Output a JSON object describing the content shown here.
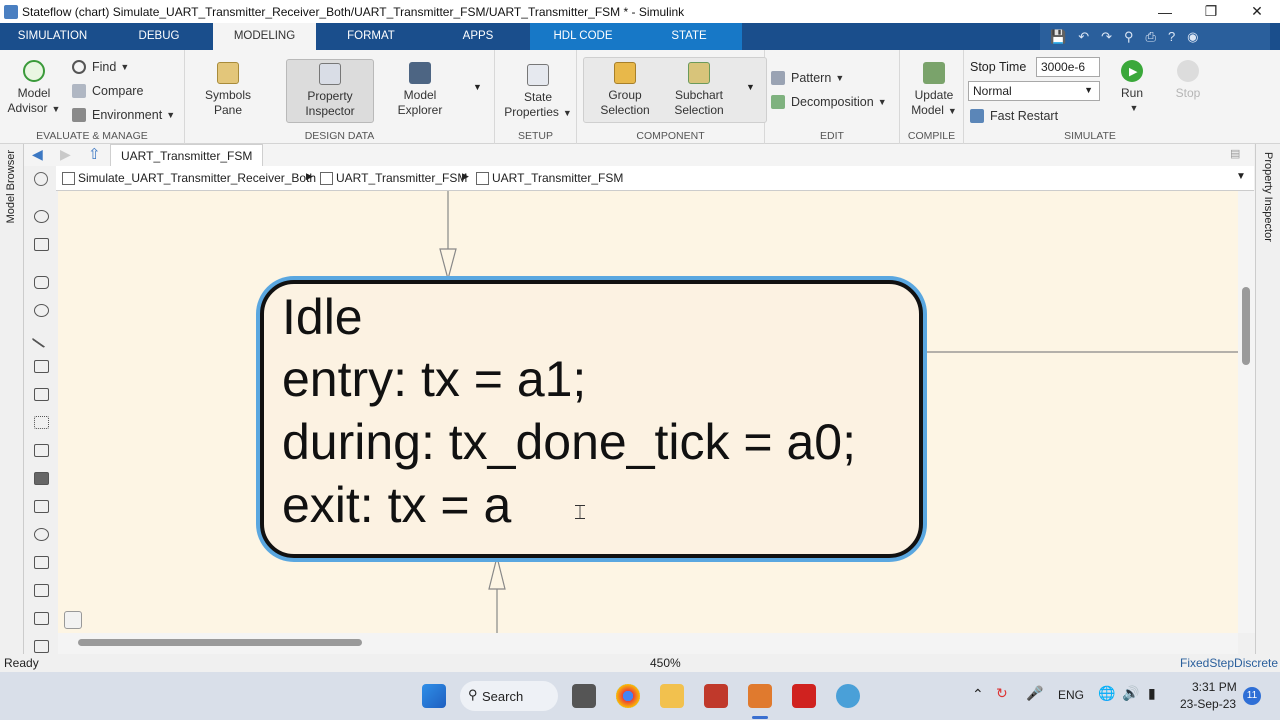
{
  "window": {
    "title": "Stateflow (chart) Simulate_UART_Transmitter_Receiver_Both/UART_Transmitter_FSM/UART_Transmitter_FSM * - Simulink"
  },
  "tabs": [
    "SIMULATION",
    "DEBUG",
    "MODELING",
    "FORMAT",
    "APPS",
    "HDL CODE",
    "STATE"
  ],
  "active_tab": "MODELING",
  "ribbon": {
    "evaluate": {
      "model_advisor": "Model\nAdvisor",
      "model_label": "Model",
      "advisor_label": "Advisor",
      "find": "Find",
      "compare": "Compare",
      "environment": "Environment",
      "group_label": "EVALUATE & MANAGE"
    },
    "design": {
      "symbols1": "Symbols",
      "symbols2": "Pane",
      "property1": "Property",
      "property2": "Inspector",
      "explorer1": "Model",
      "explorer2": "Explorer",
      "group_label": "DESIGN DATA"
    },
    "setup": {
      "state1": "State",
      "state2": "Properties",
      "group_label": "SETUP"
    },
    "component": {
      "group1": "Group",
      "group2": "Selection",
      "subchart1": "Subchart",
      "subchart2": "Selection",
      "group_label": "COMPONENT"
    },
    "edit": {
      "pattern": "Pattern",
      "decomposition": "Decomposition",
      "group_label": "EDIT"
    },
    "compile": {
      "update1": "Update",
      "update2": "Model",
      "group_label": "COMPILE"
    },
    "simulate": {
      "stop_time_label": "Stop Time",
      "stop_time_value": "3000e-6",
      "mode_value": "Normal",
      "fast_restart": "Fast Restart",
      "run": "Run",
      "stop": "Stop",
      "group_label": "SIMULATE"
    }
  },
  "nav": {
    "current": "UART_Transmitter_FSM"
  },
  "breadcrumb": [
    "Simulate_UART_Transmitter_Receiver_Both",
    "UART_Transmitter_FSM",
    "UART_Transmitter_FSM"
  ],
  "side": {
    "left_label": "Model Browser",
    "right_label": "Property Inspector"
  },
  "state": {
    "name": "Idle",
    "entry": "entry: tx = a1;",
    "during": "during: tx_done_tick = a0;",
    "exit": "exit: tx = a"
  },
  "status": {
    "left": "Ready",
    "zoom": "450%",
    "solver": "FixedStepDiscrete"
  },
  "taskbar": {
    "search": "Search",
    "lang": "ENG",
    "time": "3:31 PM",
    "date": "23-Sep-23",
    "notif": "11"
  },
  "colors": {
    "tab_bar": "#1a4e8c",
    "state_highlight": "#5aa7e0",
    "canvas": "#fdf5e4"
  }
}
